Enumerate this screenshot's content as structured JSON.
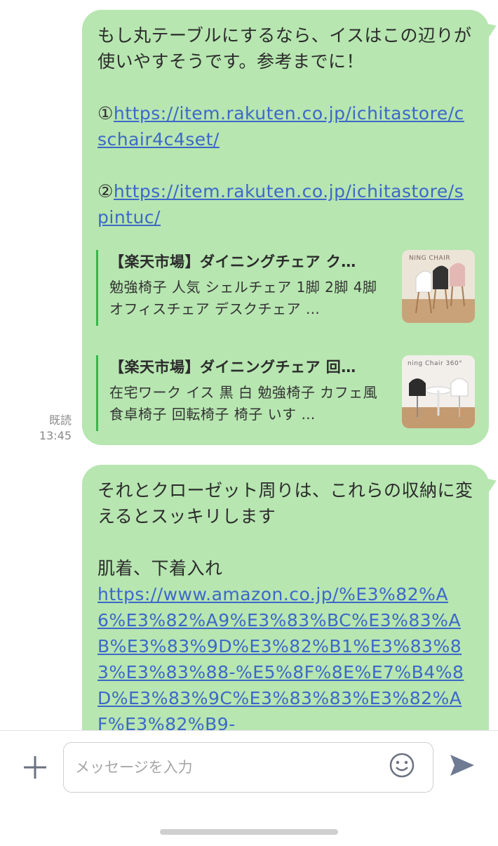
{
  "messages": [
    {
      "text_line": "もし丸テーブルにするなら、イスはこの辺りが使いやすそうです。参考までに！",
      "links": [
        {
          "prefix": "①",
          "url": "https://item.rakuten.co.jp/ichitastore/cschair4c4set/"
        },
        {
          "prefix": "②",
          "url": "https://item.rakuten.co.jp/ichitastore/spintuc/"
        }
      ],
      "previews": [
        {
          "title": "【楽天市場】ダイニングチェア ク…",
          "desc": "勉強椅子 人気 シェルチェア 1脚 2脚 4脚 オフィスチェア デスクチェア …",
          "thumb_text": "NING CHAIR"
        },
        {
          "title": "【楽天市場】ダイニングチェア 回…",
          "desc": "在宅ワーク イス 黒 白 勉強椅子 カフェ風 食卓椅子 回転椅子 椅子 いす …",
          "thumb_text": "ning Chair 360°"
        }
      ],
      "read_label": "既読",
      "time": "13:45"
    },
    {
      "text_line": "それとクローゼット周りは、これらの収納に変えるとスッキリします",
      "caption": "肌着、下着入れ",
      "url": "https://www.amazon.co.jp/%E3%82%A6%E3%82%A9%E3%83%BC%E3%83%AB%E3%83%9D%E3%82%B1%E3%83%83%E3%83%88-%E5%8F%8E%E7%B4%8D%E3%83%9C%E3%83%83%E3%82%AF%E3%82%B9-"
    }
  ],
  "composer": {
    "placeholder": "メッセージを入力",
    "plus_icon": "plus-icon",
    "emoji_icon": "smiley-icon",
    "send_icon": "send-icon"
  },
  "colors": {
    "bubble": "#b7e6b0",
    "link": "#3d68c8",
    "preview_bar": "#39b54a"
  }
}
